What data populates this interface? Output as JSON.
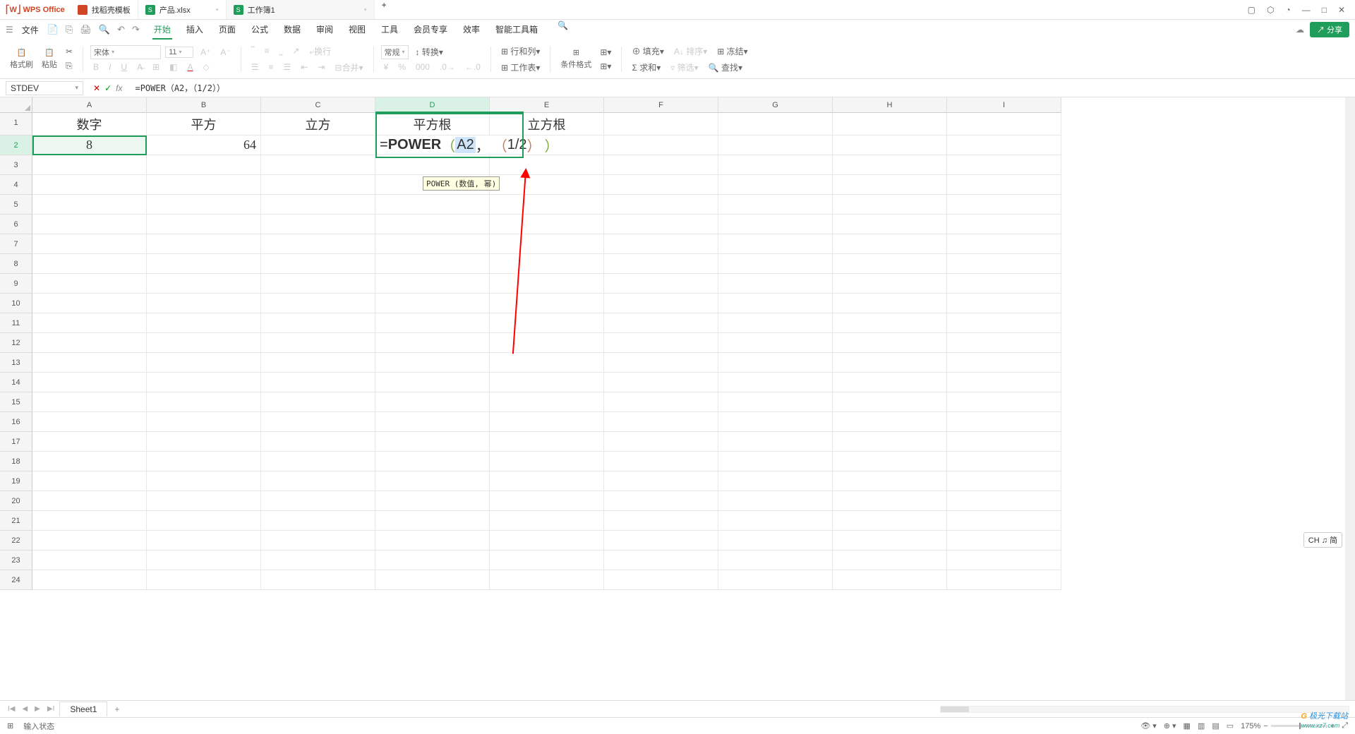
{
  "titlebar": {
    "app": "WPS Office",
    "tabs": [
      {
        "icon": "#d14424",
        "label": "找稻壳模板"
      },
      {
        "icon": "#1e9e5a",
        "label": "产品.xlsx"
      },
      {
        "icon": "#1e9e5a",
        "label": "工作簿1",
        "active": true
      }
    ]
  },
  "menus": {
    "file": "文件",
    "items": [
      "开始",
      "插入",
      "页面",
      "公式",
      "数据",
      "审阅",
      "视图",
      "工具",
      "会员专享",
      "效率",
      "智能工具箱"
    ],
    "active": "开始",
    "share": "分享"
  },
  "ribbon": {
    "format_painter": "格式刷",
    "paste": "粘贴",
    "font_name": "宋体",
    "font_size": "11",
    "general": "常规",
    "convert": "转换",
    "rowcol": "行和列",
    "worksheet": "工作表",
    "cond_format": "条件格式",
    "fill": "填充",
    "sort": "排序",
    "sum": "求和",
    "filter": "筛选",
    "freeze": "冻结",
    "find": "查找"
  },
  "formulabar": {
    "name": "STDEV",
    "formula": "=POWER（A2，（1/2））"
  },
  "columns": [
    "A",
    "B",
    "C",
    "D",
    "E",
    "F",
    "G",
    "H",
    "I"
  ],
  "headers": {
    "a": "数字",
    "b": "平方",
    "c": "立方",
    "d": "平方根",
    "e": "立方根"
  },
  "data": {
    "a2": "8",
    "b2": "64",
    "d2_formula_parts": {
      "eq": "=",
      "fn": "POWER",
      "lp1": "（",
      "ref": "A2",
      "comma": "，",
      "lp2": "（",
      "frac": "1/2",
      "rp2": "）",
      "rp1": "）"
    }
  },
  "tooltip": {
    "text": "POWER (数值, 幂)"
  },
  "sheettabs": {
    "sheet1": "Sheet1"
  },
  "status": {
    "mode": "输入状态",
    "ime": "CH ♫ 简",
    "zoom": "175%"
  },
  "watermark": {
    "brand": "极光下载站",
    "url": "www.xz7.com"
  }
}
